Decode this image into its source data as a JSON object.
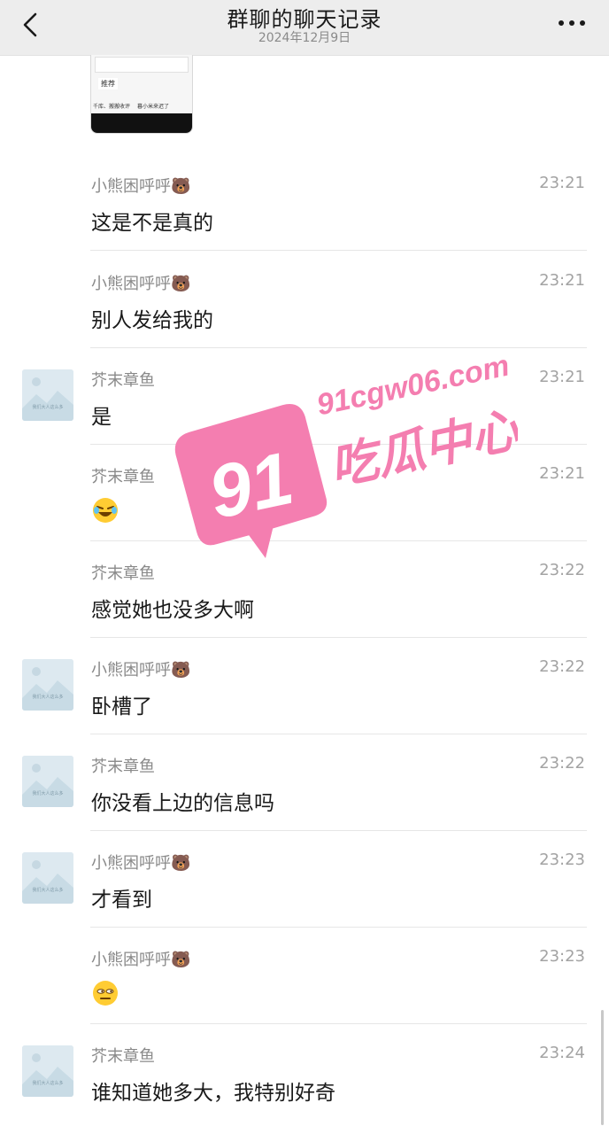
{
  "header": {
    "title": "群聊的聊天记录",
    "date": "2024年12月9日",
    "back_icon": "chevron-left-icon",
    "more_icon": "more-dots-icon"
  },
  "top_image": {
    "label_tab": "推荐",
    "label_bottom_left": "千库、搬搬收评",
    "label_bottom_right": "暮小米来迟了"
  },
  "avatar_caption": "我们大人这么多",
  "messages": [
    {
      "sender": "小熊困呼呼🐻",
      "time": "23:21",
      "text": "这是不是真的",
      "has_avatar": false
    },
    {
      "sender": "小熊困呼呼🐻",
      "time": "23:21",
      "text": "别人发给我的",
      "has_avatar": false
    },
    {
      "sender": "芥末章鱼",
      "time": "23:21",
      "text": "是",
      "has_avatar": true
    },
    {
      "sender": "芥末章鱼",
      "time": "23:21",
      "emoji": "😂",
      "emoji_name": "laughing-emoji-icon",
      "has_avatar": false
    },
    {
      "sender": "芥末章鱼",
      "time": "23:22",
      "text": "感觉她也没多大啊",
      "has_avatar": false
    },
    {
      "sender": "小熊困呼呼🐻",
      "time": "23:22",
      "text": "卧槽了",
      "has_avatar": true
    },
    {
      "sender": "芥末章鱼",
      "time": "23:22",
      "text": "你没看上边的信息吗",
      "has_avatar": true
    },
    {
      "sender": "小熊困呼呼🐻",
      "time": "23:23",
      "text": "才看到",
      "has_avatar": true
    },
    {
      "sender": "小熊困呼呼🐻",
      "time": "23:23",
      "emoji": "😑",
      "emoji_name": "unamused-emoji-icon",
      "has_avatar": false
    },
    {
      "sender": "芥末章鱼",
      "time": "23:24",
      "text": "谁知道她多大，我特别好奇",
      "has_avatar": true
    }
  ],
  "watermark": {
    "url": "91cgw06.com",
    "number": "91",
    "name": "吃瓜中心",
    "color": "#f47eb0"
  }
}
